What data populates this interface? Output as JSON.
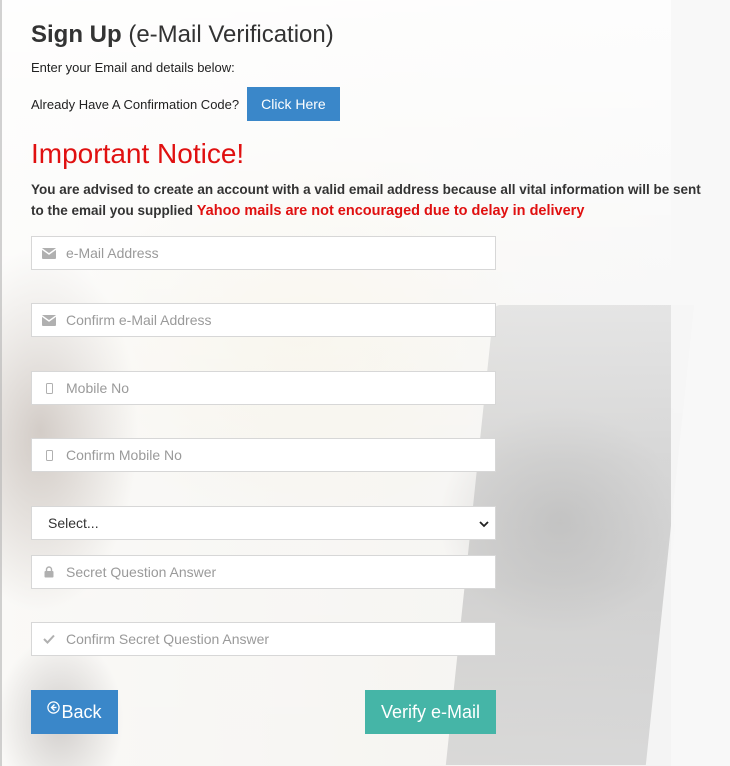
{
  "header": {
    "title_bold": "Sign Up",
    "title_rest": "(e-Mail Verification)",
    "subtitle": "Enter your Email and details below:"
  },
  "confirmation": {
    "label": "Already Have A Confirmation Code?",
    "button_label": "Click Here"
  },
  "notice": {
    "heading": "Important Notice!",
    "text": "You are advised to create an account with a valid email address because all vital information will be sent to the email you supplied",
    "warning": "Yahoo mails are not encouraged due to delay in delivery"
  },
  "form": {
    "email": {
      "placeholder": "e-Mail Address",
      "icon": "envelope-icon"
    },
    "confirm_email": {
      "placeholder": "Confirm e-Mail Address",
      "icon": "envelope-icon"
    },
    "mobile": {
      "placeholder": "Mobile No",
      "icon": "mobile-icon"
    },
    "confirm_mobile": {
      "placeholder": "Confirm Mobile No",
      "icon": "mobile-icon"
    },
    "secret_question": {
      "selected": "Select..."
    },
    "secret_answer": {
      "placeholder": "Secret Question Answer",
      "icon": "lock-icon"
    },
    "confirm_secret_answer": {
      "placeholder": "Confirm Secret Question Answer",
      "icon": "check-icon"
    }
  },
  "actions": {
    "back_label": "Back",
    "verify_label": "Verify e-Mail"
  },
  "colors": {
    "primary_button": "#3a87c9",
    "verify_button": "#45b5a7",
    "notice_red": "#e01010"
  }
}
